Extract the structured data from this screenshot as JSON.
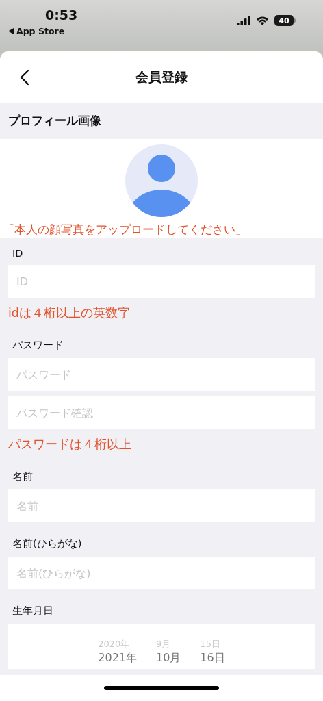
{
  "status_bar": {
    "time": "0:53",
    "back_app": "App Store",
    "battery": "40"
  },
  "nav": {
    "title": "会員登録"
  },
  "profile": {
    "header": "プロフィール画像",
    "note": "「本人の顔写真をアップロードしてください」"
  },
  "sections": [
    {
      "label": "ID",
      "fields": [
        {
          "placeholder": "ID"
        }
      ],
      "hint": "idは４桁以上の英数字"
    },
    {
      "label": "パスワード",
      "fields": [
        {
          "placeholder": "パスワード"
        },
        {
          "placeholder": "パスワード確認"
        }
      ],
      "hint": "パスワードは４桁以上"
    },
    {
      "label": "名前",
      "fields": [
        {
          "placeholder": "名前"
        }
      ]
    },
    {
      "label": "名前(ひらがな)",
      "fields": [
        {
          "placeholder": "名前(ひらがな)"
        }
      ]
    }
  ],
  "birthday": {
    "label": "生年月日",
    "columns": [
      {
        "items": [
          {
            "label": "2020年",
            "selected": false
          },
          {
            "label": "2021年",
            "selected": true
          }
        ]
      },
      {
        "items": [
          {
            "label": "9月",
            "selected": false
          },
          {
            "label": "10月",
            "selected": true
          }
        ]
      },
      {
        "items": [
          {
            "label": "15日",
            "selected": false
          },
          {
            "label": "16日",
            "selected": true
          }
        ]
      }
    ]
  }
}
